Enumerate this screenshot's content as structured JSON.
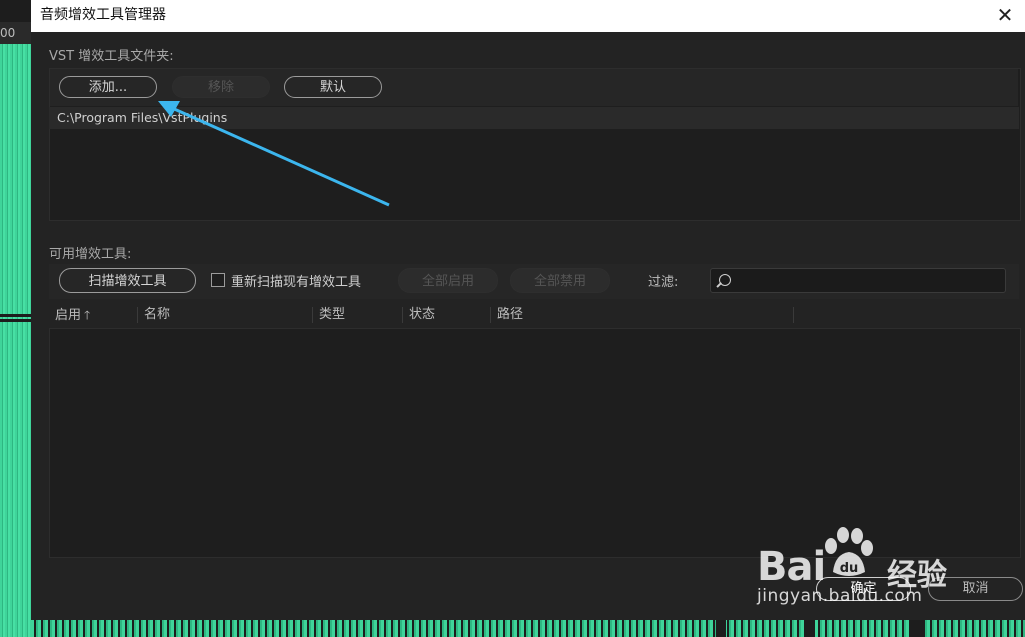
{
  "dialog": {
    "title": "音频增效工具管理器",
    "close_glyph": "✕"
  },
  "background": {
    "ruler_text": "00"
  },
  "vst_section": {
    "label": "VST 增效工具文件夹:",
    "buttons": {
      "add": "添加...",
      "remove": "移除",
      "default": "默认"
    },
    "folders": [
      "C:\\Program Files\\VstPlugins"
    ]
  },
  "plugins_section": {
    "label": "可用增效工具:",
    "scan_button": "扫描增效工具",
    "rescan_checkbox_label": "重新扫描现有增效工具",
    "rescan_checked": false,
    "enable_all": "全部启用",
    "disable_all": "全部禁用",
    "filter_label": "过滤:",
    "filter_value": "",
    "columns": [
      {
        "label": "启用",
        "sort_icon": "arrow-up-icon"
      },
      {
        "label": "名称"
      },
      {
        "label": "类型"
      },
      {
        "label": "状态"
      },
      {
        "label": "路径"
      }
    ]
  },
  "footer": {
    "ok": "确定",
    "cancel": "取消"
  },
  "watermark": {
    "brand_text": "Bai",
    "brand_suffix": "经验",
    "url": "jingyan.baidu.com"
  },
  "colors": {
    "annotation_arrow": "#3cb6ee",
    "waveform": "#3fd49a"
  }
}
